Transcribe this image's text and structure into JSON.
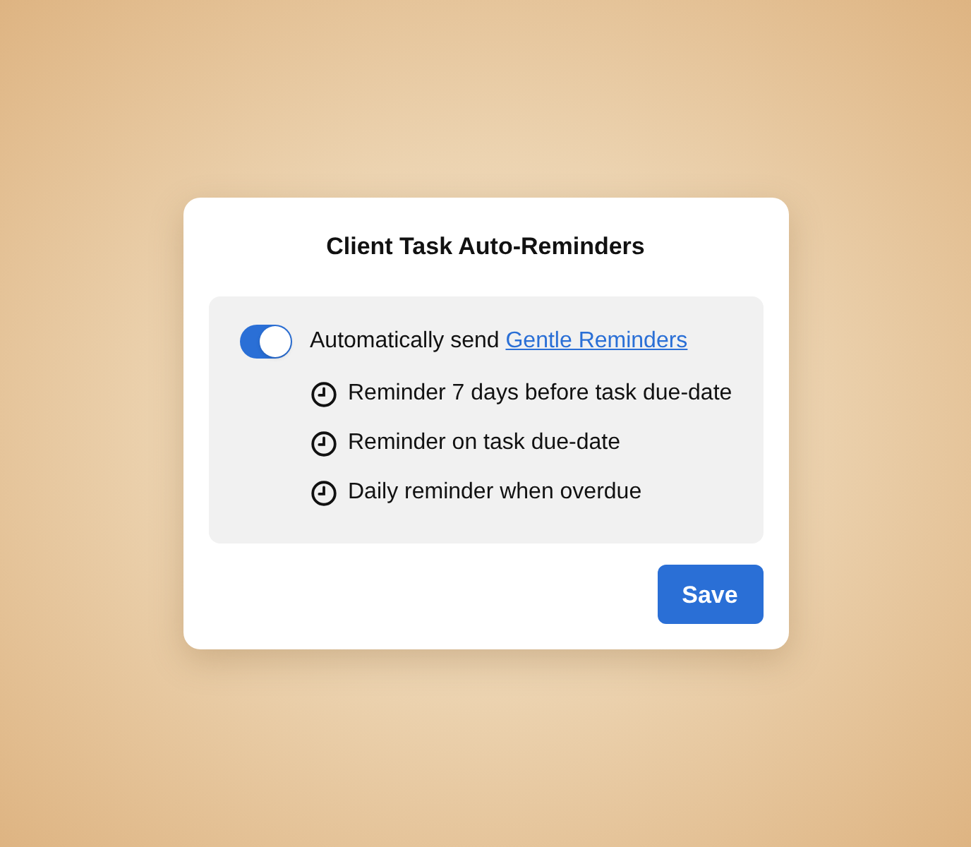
{
  "dialog": {
    "title": "Client Task Auto-Reminders"
  },
  "auto_send": {
    "on": true,
    "text": "Automatically send ",
    "link": "Gentle Reminders"
  },
  "reminders": [
    {
      "label": "Reminder 7 days before task due-date"
    },
    {
      "label": "Reminder on task due-date"
    },
    {
      "label": "Daily reminder when overdue"
    }
  ],
  "buttons": [
    "Save"
  ]
}
